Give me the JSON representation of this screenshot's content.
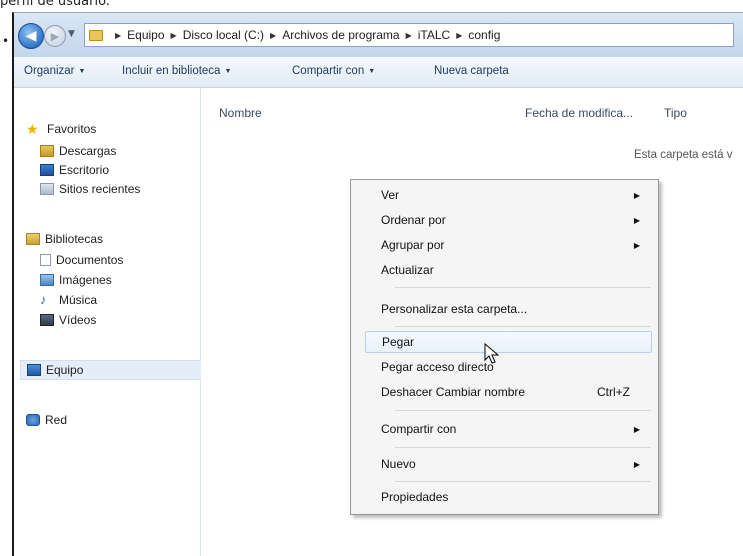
{
  "caption": "perfil de usuario.",
  "window": {
    "address": {
      "crumbs": [
        "Equipo",
        "Disco local (C:)",
        "Archivos de programa",
        "iTALC",
        "config"
      ]
    },
    "toolbar": {
      "organize": "Organizar",
      "include_library": "Incluir en biblioteca",
      "share_with": "Compartir con",
      "new_folder": "Nueva carpeta"
    },
    "nav": {
      "favorites": "Favoritos",
      "downloads": "Descargas",
      "desktop": "Escritorio",
      "recent": "Sitios recientes",
      "libraries": "Bibliotecas",
      "documents": "Documentos",
      "images": "Imágenes",
      "music": "Música",
      "videos": "Vídeos",
      "computer": "Equipo",
      "network": "Red"
    },
    "columns": {
      "name": "Nombre",
      "date": "Fecha de modifica...",
      "type": "Tipo"
    },
    "empty_text": "Esta carpeta está v"
  },
  "context_menu": {
    "view": "Ver",
    "sort_by": "Ordenar por",
    "group_by": "Agrupar por",
    "refresh": "Actualizar",
    "customize": "Personalizar esta carpeta...",
    "paste": "Pegar",
    "paste_shortcut": "Pegar acceso directo",
    "undo_rename": "Deshacer Cambiar nombre",
    "undo_shortcut": "Ctrl+Z",
    "share_with": "Compartir con",
    "new": "Nuevo",
    "properties": "Propiedades"
  }
}
